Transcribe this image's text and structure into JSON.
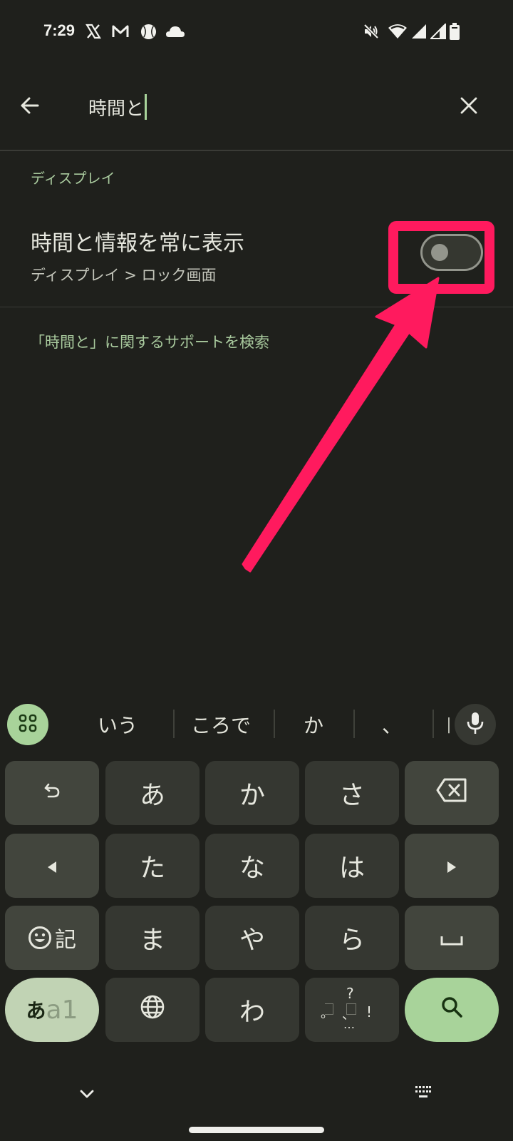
{
  "status_bar": {
    "time": "7:29",
    "notification_icons": [
      "x-icon",
      "mail-m-icon",
      "baseball-icon",
      "cloud-icon"
    ],
    "system_icons": [
      "mute-icon",
      "wifi-icon",
      "signal-full-icon",
      "signal-partial-icon",
      "battery-icon"
    ]
  },
  "search": {
    "query": "時間と",
    "back_icon": "arrow-left-icon",
    "clear_icon": "close-icon"
  },
  "results": {
    "section_label": "ディスプレイ",
    "items": [
      {
        "title": "時間と情報を常に表示",
        "path": "ディスプレイ > ロック画面",
        "toggle_on": false
      }
    ],
    "support_link": "「時間と」に関するサポートを検索"
  },
  "annotation": {
    "color": "#ff1a5e",
    "type": "highlight-box-with-arrow"
  },
  "keyboard": {
    "candidates": [
      "いう",
      "ころで",
      "か",
      "、",
      "|"
    ],
    "rows": [
      [
        {
          "label": "",
          "icon": "undo-icon",
          "type": "func",
          "name": "undo-key"
        },
        {
          "label": "あ",
          "type": "char",
          "name": "key-a"
        },
        {
          "label": "か",
          "type": "char",
          "name": "key-ka"
        },
        {
          "label": "さ",
          "type": "char",
          "name": "key-sa"
        },
        {
          "label": "",
          "icon": "backspace-icon",
          "type": "func",
          "name": "backspace-key"
        }
      ],
      [
        {
          "label": "",
          "icon": "cursor-left-icon",
          "type": "func",
          "name": "cursor-left-key"
        },
        {
          "label": "た",
          "type": "char",
          "name": "key-ta"
        },
        {
          "label": "な",
          "type": "char",
          "name": "key-na"
        },
        {
          "label": "は",
          "type": "char",
          "name": "key-ha"
        },
        {
          "label": "",
          "icon": "cursor-right-icon",
          "type": "func",
          "name": "cursor-right-key"
        }
      ],
      [
        {
          "label": "記",
          "icon": "emoji-icon",
          "type": "func",
          "name": "emoji-symbol-key"
        },
        {
          "label": "ま",
          "type": "char",
          "name": "key-ma"
        },
        {
          "label": "や",
          "type": "char",
          "name": "key-ya"
        },
        {
          "label": "ら",
          "type": "char",
          "name": "key-ra"
        },
        {
          "label": "",
          "icon": "space-icon",
          "type": "func",
          "name": "space-key"
        }
      ],
      [
        {
          "label_kana": "あ",
          "label_alpha": "a1",
          "type": "mode",
          "name": "input-mode-key"
        },
        {
          "label": "",
          "icon": "globe-icon",
          "type": "char",
          "name": "language-key"
        },
        {
          "label": "わ",
          "type": "char",
          "name": "key-wa"
        },
        {
          "punct": {
            "top": "?",
            "left": "。",
            "mid": "、",
            "right": "!",
            "bottom": "…"
          },
          "type": "char",
          "name": "punctuation-key"
        },
        {
          "label": "",
          "icon": "search-icon",
          "type": "enter",
          "name": "search-enter-key"
        }
      ]
    ]
  },
  "nav": {
    "hide_keyboard_icon": "chevron-down-icon",
    "switch_keyboard_icon": "keyboard-icon"
  }
}
